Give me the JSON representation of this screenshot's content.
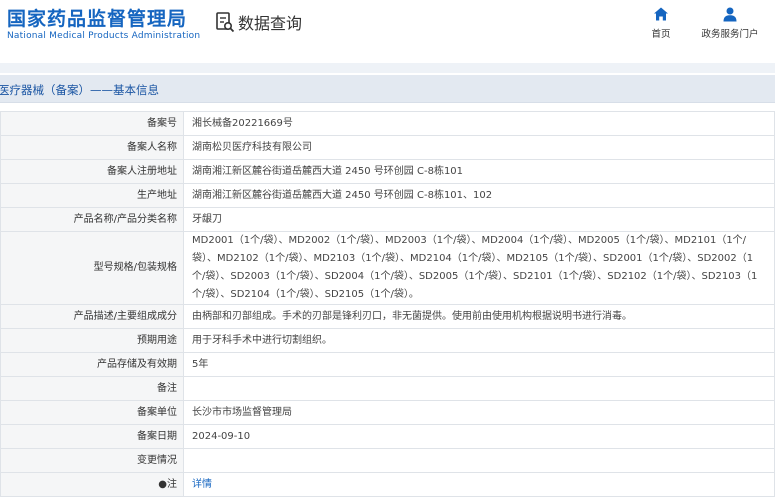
{
  "header": {
    "brand_cn": "国家药品监督管理局",
    "brand_en": "National Medical Products Administration",
    "query_title": "数据查询",
    "nav": {
      "home_label": "首页",
      "services_label": "政务服务门户"
    }
  },
  "section": {
    "title": "医疗器械（备案）——基本信息"
  },
  "record": [
    {
      "key": "备案号",
      "value": "湘长械备20221669号"
    },
    {
      "key": "备案人名称",
      "value": "湖南松贝医疗科技有限公司"
    },
    {
      "key": "备案人注册地址",
      "value": "湖南湘江新区麓谷街道岳麓西大道 2450 号环创园 C-8栋101"
    },
    {
      "key": "生产地址",
      "value": "湖南湘江新区麓谷街道岳麓西大道 2450 号环创园 C-8栋101、102"
    },
    {
      "key": "产品名称/产品分类名称",
      "value": "牙龈刀"
    },
    {
      "key": "型号规格/包装规格",
      "value": "MD2001（1个/袋）、MD2002（1个/袋）、MD2003（1个/袋）、MD2004（1个/袋）、MD2005（1个/袋）、MD2101（1个/袋）、MD2102（1个/袋）、MD2103（1个/袋）、MD2104（1个/袋）、MD2105（1个/袋）、SD2001（1个/袋）、SD2002（1个/袋）、SD2003（1个/袋）、SD2004（1个/袋）、SD2005（1个/袋）、SD2101（1个/袋）、SD2102（1个/袋）、SD2103（1个/袋）、SD2104（1个/袋）、SD2105（1个/袋）。"
    },
    {
      "key": "产品描述/主要组成成分",
      "value": "由柄部和刃部组成。手术的刃部是锋利刃口，非无菌提供。使用前由使用机构根据说明书进行消毒。"
    },
    {
      "key": "预期用途",
      "value": "用于牙科手术中进行切割组织。"
    },
    {
      "key": "产品存储及有效期",
      "value": "5年"
    },
    {
      "key": "备注",
      "value": ""
    },
    {
      "key": "备案单位",
      "value": "长沙市市场监督管理局"
    },
    {
      "key": "备案日期",
      "value": "2024-09-10"
    },
    {
      "key": "变更情况",
      "value": ""
    },
    {
      "key": "●注",
      "value": "详情"
    }
  ],
  "colors": {
    "brand_blue": "#1565c0",
    "section_bg": "#e3e9f1",
    "key_cell_bg": "#f5f6f7"
  }
}
